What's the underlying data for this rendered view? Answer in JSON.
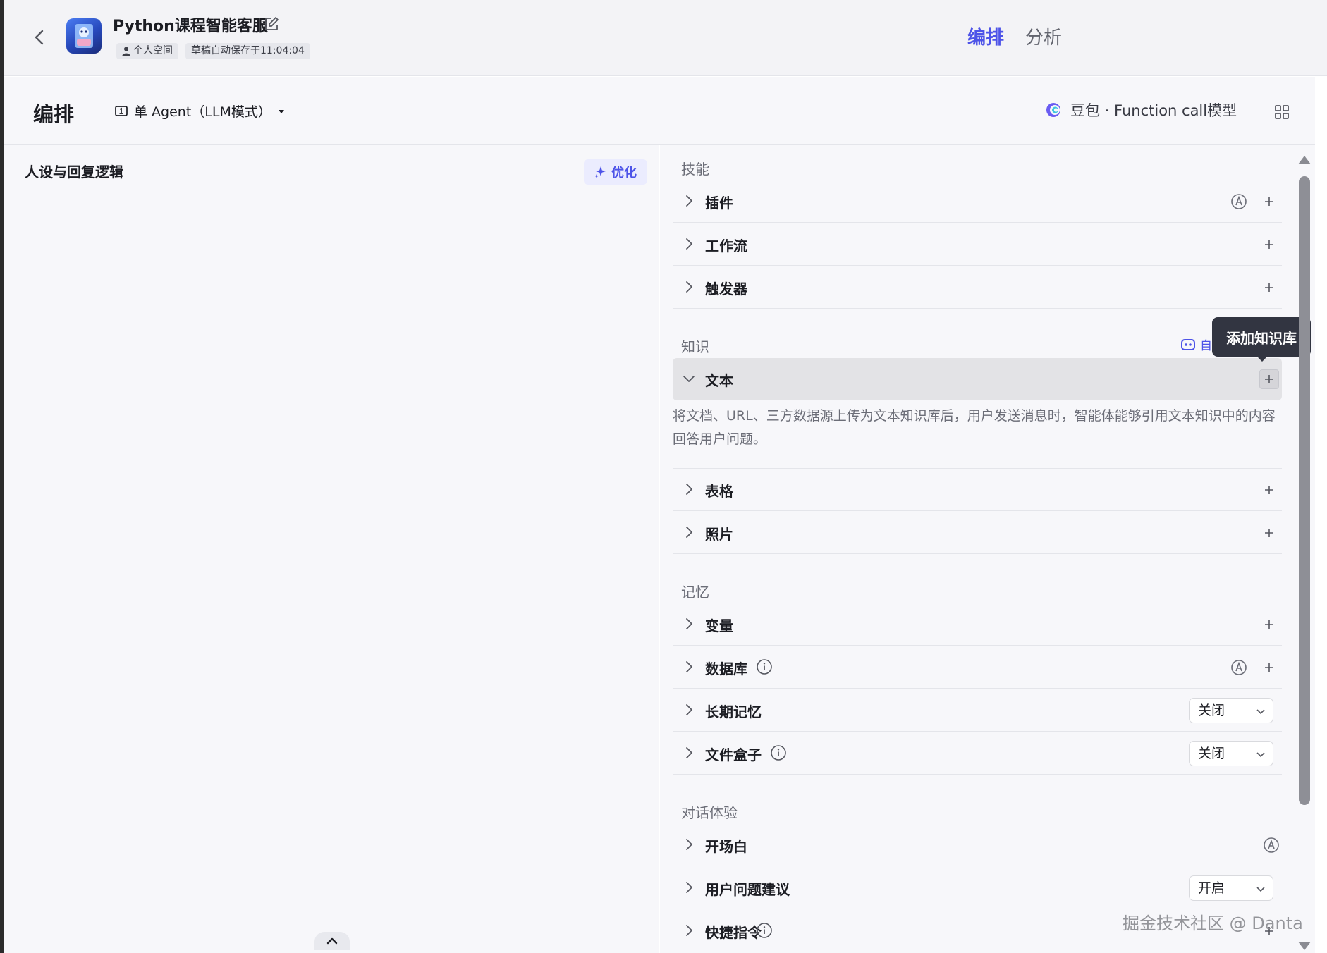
{
  "header": {
    "app_title": "Python课程智能客服",
    "space_tag": "个人空间",
    "autosave_tag": "草稿自动保存于11:04:04",
    "tabs": [
      {
        "label": "编排",
        "active": true
      },
      {
        "label": "分析",
        "active": false
      }
    ]
  },
  "toolbar": {
    "title": "编排",
    "mode_label": "单 Agent（LLM模式）",
    "model_label": "豆包 · Function call模型"
  },
  "left": {
    "persona_title": "人设与回复逻辑",
    "optimize_label": "优化"
  },
  "sections": {
    "skills": {
      "title": "技能",
      "items": [
        {
          "label": "插件"
        },
        {
          "label": "工作流"
        },
        {
          "label": "触发器"
        }
      ]
    },
    "knowledge": {
      "title": "知识",
      "auto_call": "自",
      "items": [
        {
          "label": "文本",
          "description": "将文档、URL、三方数据源上传为文本知识库后，用户发送消息时，智能体能够引用文本知识中的内容回答用户问题。"
        },
        {
          "label": "表格"
        },
        {
          "label": "照片"
        }
      ]
    },
    "memory": {
      "title": "记忆",
      "items": [
        {
          "label": "变量"
        },
        {
          "label": "数据库"
        },
        {
          "label": "长期记忆",
          "value": "关闭"
        },
        {
          "label": "文件盒子",
          "value": "关闭"
        }
      ]
    },
    "dialog": {
      "title": "对话体验",
      "items": [
        {
          "label": "开场白"
        },
        {
          "label": "用户问题建议",
          "value": "开启"
        },
        {
          "label": "快捷指令"
        }
      ]
    }
  },
  "tooltip": "添加知识库",
  "watermark": "掘金技术社区 @ Danta",
  "colors": {
    "accent": "#4d53e8",
    "text": "#1c1d23",
    "muted": "#6b6d77",
    "panel_bg": "#f7f7fa",
    "tooltip_bg": "#323541"
  }
}
